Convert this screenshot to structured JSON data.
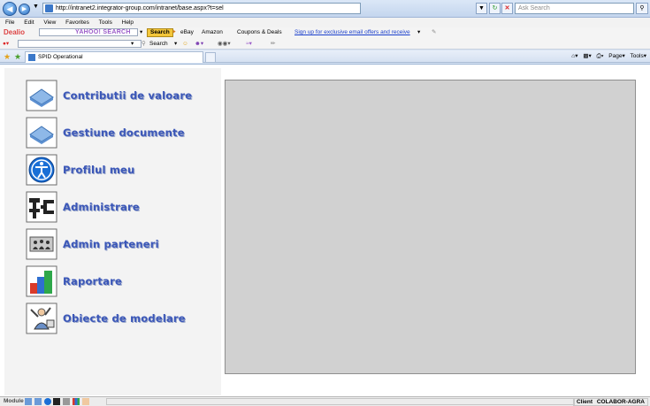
{
  "browser": {
    "address": "http://intranet2.integrator-group.com/intranet/base.aspx?t=sel",
    "search_placeholder": "Ask Search",
    "menu": [
      "File",
      "Edit",
      "View",
      "Favorites",
      "Tools",
      "Help"
    ],
    "toolbar1": {
      "logo": "Dealio",
      "yahoo_logo": "YAHOO! SEARCH",
      "search_button": "Search",
      "ebay": "eBay",
      "amazon": "Amazon",
      "coupons": "Coupons & Deals",
      "signup_link": "Sign up for exclusive email offers and receive"
    },
    "toolbar2": {
      "search_label": "Search"
    },
    "tab_title": "SPID Operational",
    "right_tools": {
      "page": "Page",
      "tools": "Tools"
    }
  },
  "menu_items": [
    {
      "label": "Contributii de valoare",
      "icon": "folder-icon"
    },
    {
      "label": "Gestiune documente",
      "icon": "folder-icon"
    },
    {
      "label": "Profilul meu",
      "icon": "accessibility-person-icon"
    },
    {
      "label": "Administrare",
      "icon": "tools-icon"
    },
    {
      "label": "Admin parteneri",
      "icon": "partners-icon"
    },
    {
      "label": "Raportare",
      "icon": "bar-chart-icon"
    },
    {
      "label": "Obiecte de modelare",
      "icon": "modeling-icon"
    }
  ],
  "status": {
    "module_label": "Module",
    "client_label": "Client",
    "client_value": "COLABOR-AGRA"
  }
}
